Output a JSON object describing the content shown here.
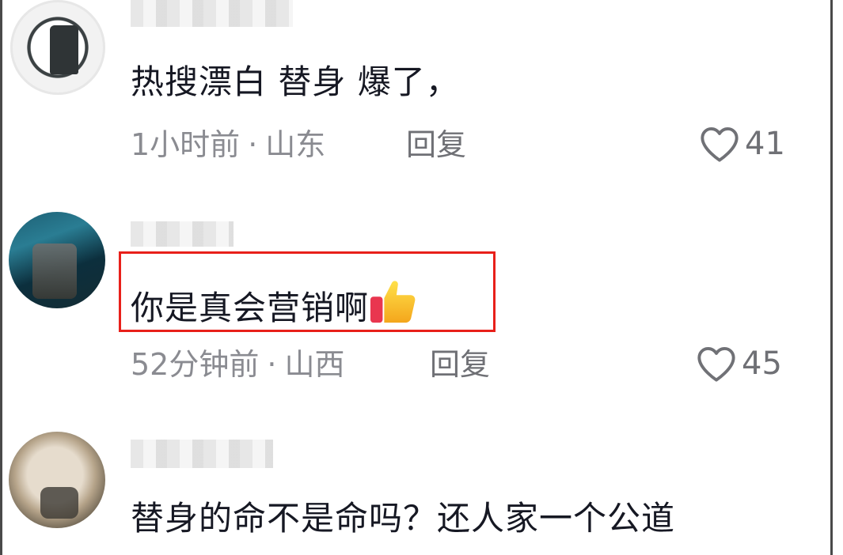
{
  "comments": [
    {
      "content": "热搜漂白 替身 爆了，",
      "time": "1小时前",
      "separator": "·",
      "location": "山东",
      "reply_label": "回复",
      "likes": "41"
    },
    {
      "content": "你是真会营销啊",
      "emoji": "thumbs-up-icon",
      "time": "52分钟前",
      "separator": "·",
      "location": "山西",
      "reply_label": "回复",
      "likes": "45",
      "highlighted": true,
      "highlight_color": "#e8201a"
    },
    {
      "content": "替身的命不是命吗？还人家一个公道"
    }
  ],
  "colors": {
    "text": "#161823",
    "meta": "#8a8b91",
    "highlight": "#e8201a"
  }
}
